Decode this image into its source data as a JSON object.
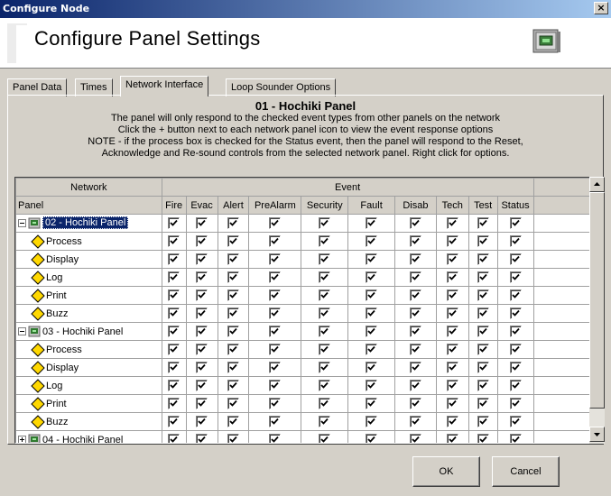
{
  "window": {
    "title": "Configure Node",
    "close_glyph": "×"
  },
  "header": {
    "title": "Configure Panel Settings",
    "icon": "panel-device-icon"
  },
  "tabs": [
    {
      "label": "Panel Data",
      "active": false
    },
    {
      "label": "Times",
      "active": false
    },
    {
      "label": "Network Interface",
      "active": true
    },
    {
      "label": "Loop Sounder Options",
      "active": false
    }
  ],
  "info": {
    "panel_title": "01 - Hochiki Panel",
    "lines": [
      "The panel will only respond to the checked event types from other panels on the network",
      "Click the + button next to each network panel icon to view the event response options",
      "NOTE - if the process box is checked for the Status event, then the panel will respond to the Reset,",
      "Acknowledge and Re-sound controls from the selected network panel. Right click for options."
    ]
  },
  "grid": {
    "group_headers": {
      "network": "Network",
      "event": "Event"
    },
    "panel_header": "Panel",
    "columns": [
      "Fire",
      "Evac",
      "Alert",
      "PreAlarm",
      "Security",
      "Fault",
      "Disab",
      "Tech",
      "Test",
      "Status"
    ],
    "rows": [
      {
        "label": "02 - Hochiki Panel",
        "type": "panel",
        "expander": "minus",
        "selected": true,
        "checks": [
          true,
          true,
          true,
          true,
          true,
          true,
          true,
          true,
          true,
          true
        ]
      },
      {
        "label": "Process",
        "type": "option",
        "checks": [
          true,
          true,
          true,
          true,
          true,
          true,
          true,
          true,
          true,
          true
        ]
      },
      {
        "label": "Display",
        "type": "option",
        "checks": [
          true,
          true,
          true,
          true,
          true,
          true,
          true,
          true,
          true,
          true
        ]
      },
      {
        "label": "Log",
        "type": "option",
        "checks": [
          true,
          true,
          true,
          true,
          true,
          true,
          true,
          true,
          true,
          true
        ]
      },
      {
        "label": "Print",
        "type": "option",
        "checks": [
          true,
          true,
          true,
          true,
          true,
          true,
          true,
          true,
          true,
          true
        ]
      },
      {
        "label": "Buzz",
        "type": "option",
        "checks": [
          true,
          true,
          true,
          true,
          true,
          true,
          true,
          true,
          true,
          true
        ]
      },
      {
        "label": "03 - Hochiki Panel",
        "type": "panel",
        "expander": "minus",
        "selected": false,
        "checks": [
          true,
          true,
          true,
          true,
          true,
          true,
          true,
          true,
          true,
          true
        ]
      },
      {
        "label": "Process",
        "type": "option",
        "checks": [
          true,
          true,
          true,
          true,
          true,
          true,
          true,
          true,
          true,
          true
        ]
      },
      {
        "label": "Display",
        "type": "option",
        "checks": [
          true,
          true,
          true,
          true,
          true,
          true,
          true,
          true,
          true,
          true
        ]
      },
      {
        "label": "Log",
        "type": "option",
        "checks": [
          true,
          true,
          true,
          true,
          true,
          true,
          true,
          true,
          true,
          true
        ]
      },
      {
        "label": "Print",
        "type": "option",
        "checks": [
          true,
          true,
          true,
          true,
          true,
          true,
          true,
          true,
          true,
          true
        ]
      },
      {
        "label": "Buzz",
        "type": "option",
        "checks": [
          true,
          true,
          true,
          true,
          true,
          true,
          true,
          true,
          true,
          true
        ]
      },
      {
        "label": "04 - Hochiki Panel",
        "type": "panel",
        "expander": "plus",
        "selected": false,
        "checks": [
          true,
          true,
          true,
          true,
          true,
          true,
          true,
          true,
          true,
          true
        ]
      }
    ]
  },
  "buttons": {
    "ok": "OK",
    "cancel": "Cancel"
  },
  "colors": {
    "selection": "#0a246a",
    "dialog_bg": "#d4d0c8",
    "diamond": "#ffd800"
  }
}
